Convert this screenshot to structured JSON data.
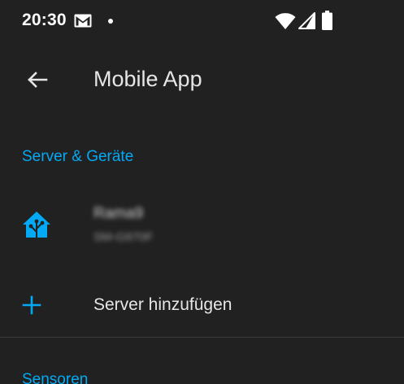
{
  "status_bar": {
    "time": "20:30",
    "icons": [
      "gmail-icon",
      "notification-dot-icon",
      "wifi-icon",
      "signal-icon",
      "battery-icon"
    ]
  },
  "app_bar": {
    "title": "Mobile App",
    "back_icon": "arrow-left-icon"
  },
  "sections": {
    "servers_header": "Server & Geräte",
    "sensors_header": "Sensoren"
  },
  "server_item": {
    "name": "Rama9",
    "device": "SM-G970F",
    "icon": "home-assistant-icon"
  },
  "add_server": {
    "label": "Server hinzufügen",
    "icon": "plus-icon"
  },
  "colors": {
    "background": "#212121",
    "accent": "#03a9f4",
    "text_primary": "#e6e6e6",
    "divider": "#3a3a3a"
  }
}
